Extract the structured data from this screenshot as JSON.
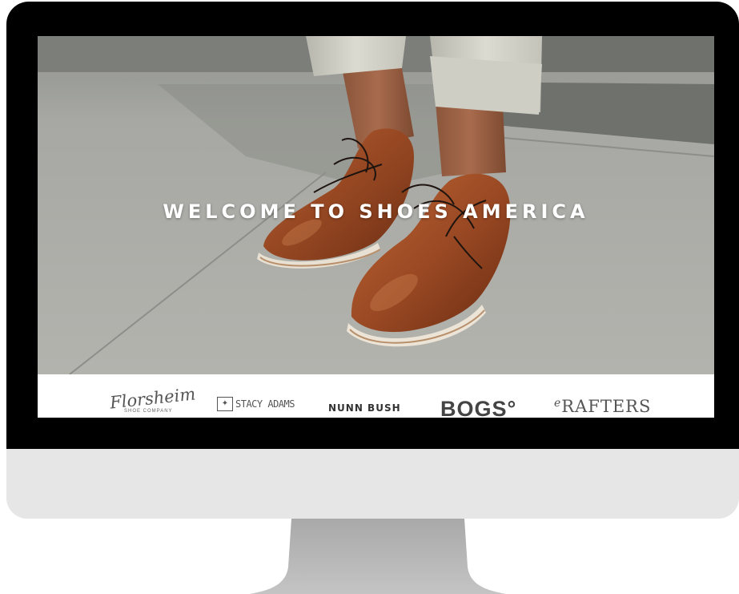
{
  "hero": {
    "title": "WELCOME TO SHOES AMERICA"
  },
  "brands": {
    "florsheim": "Florsheim",
    "florsheim_tagline": "SHOE COMPANY",
    "stacy_adams": "STACY ADAMS",
    "nunn_bush": "NUNN BUSH",
    "bogs": "BOGS°",
    "rafters": "RAFTERS"
  },
  "colors": {
    "bezel": "#000000",
    "chin": "#e6e6e6",
    "stand": "#b9b9b9",
    "hero_pavement": "#a9a9a4",
    "shoe_leather": "#9a4a22",
    "title_text": "#ffffff"
  }
}
